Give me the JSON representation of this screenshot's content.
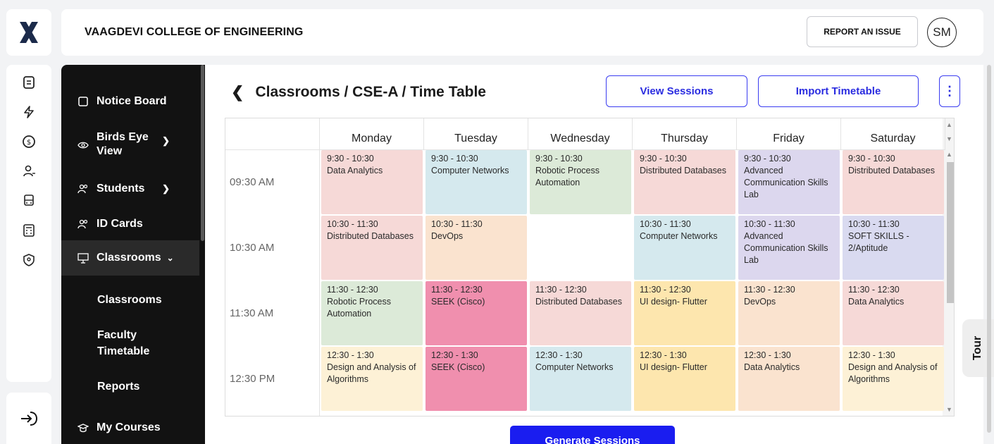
{
  "header": {
    "college_name": "VAAGDEVI COLLEGE OF ENGINEERING",
    "report_label": "REPORT AN ISSUE",
    "avatar_initials": "SM"
  },
  "rail": {
    "icons": [
      "document-icon",
      "flash-icon",
      "coin-icon",
      "user-add-icon",
      "bus-icon",
      "calculator-icon",
      "shield-icon"
    ],
    "logout_icon": "logout-icon"
  },
  "menu": {
    "items": [
      {
        "label": "Notice Board",
        "icon": "square-icon"
      },
      {
        "label": "Birds Eye View",
        "icon": "eye-icon"
      },
      {
        "label": "Students",
        "icon": "users-icon"
      },
      {
        "label": "ID Cards",
        "icon": "users-icon"
      },
      {
        "label": "Classrooms",
        "icon": "presentation-icon"
      },
      {
        "label": "My Courses",
        "icon": "graduation-icon"
      }
    ],
    "birds_eye_line1": "Birds Eye",
    "birds_eye_line2": "View",
    "sub_items": [
      "Classrooms",
      "Faculty",
      "Timetable",
      "Reports"
    ]
  },
  "page": {
    "breadcrumb": "Classrooms / CSE-A / Time Table",
    "view_sessions_label": "View Sessions",
    "import_label": "Import Timetable",
    "generate_label": "Generate Sessions",
    "tour_label": "Tour"
  },
  "timetable": {
    "days": [
      "Monday",
      "Tuesday",
      "Wednesday",
      "Thursday",
      "Friday",
      "Saturday"
    ],
    "time_labels": [
      "09:30 AM",
      "10:30 AM",
      "11:30 AM",
      "12:30 PM"
    ],
    "slots": [
      [
        {
          "time": "9:30 - 10:30",
          "subject": "Data Analytics",
          "color": "#f6d9d7"
        },
        {
          "time": "9:30 - 10:30",
          "subject": "Computer Networks",
          "color": "#d5e9ee"
        },
        {
          "time": "9:30 - 10:30",
          "subject": "Robotic Process Automation",
          "color": "#dcead8"
        },
        {
          "time": "9:30 - 10:30",
          "subject": "Distributed Databases",
          "color": "#f6d9d7"
        },
        {
          "time": "9:30 - 10:30",
          "subject": "Advanced Communication Skills Lab",
          "color": "#dcd7ee"
        },
        {
          "time": "9:30 - 10:30",
          "subject": "Distributed Databases",
          "color": "#f6d9d7"
        }
      ],
      [
        {
          "time": "10:30 - 11:30",
          "subject": "Distributed Databases",
          "color": "#f6d9d7"
        },
        {
          "time": "10:30 - 11:30",
          "subject": "DevOps",
          "color": "#fae3cf"
        },
        null,
        {
          "time": "10:30 - 11:30",
          "subject": "Computer Networks",
          "color": "#d5e9ee"
        },
        {
          "time": "10:30 - 11:30",
          "subject": "Advanced Communication Skills Lab",
          "color": "#dcd7ee"
        },
        {
          "time": "10:30 - 11:30",
          "subject": "SOFT SKILLS - 2/Aptitude",
          "color": "#d9daf0"
        }
      ],
      [
        {
          "time": "11:30 - 12:30",
          "subject": "Robotic Process Automation",
          "color": "#dcead8"
        },
        {
          "time": "11:30 - 12:30",
          "subject": "SEEK (Cisco)",
          "color": "#f08fae"
        },
        {
          "time": "11:30 - 12:30",
          "subject": "Distributed Databases",
          "color": "#f6d9d7"
        },
        {
          "time": "11:30 - 12:30",
          "subject": "UI design- Flutter",
          "color": "#fde6ae"
        },
        {
          "time": "11:30 - 12:30",
          "subject": "DevOps",
          "color": "#fae3cf"
        },
        {
          "time": "11:30 - 12:30",
          "subject": "Data Analytics",
          "color": "#f6d9d7"
        }
      ],
      [
        {
          "time": "12:30 - 1:30",
          "subject": "Design and Analysis of Algorithms",
          "color": "#fdf1d6"
        },
        {
          "time": "12:30 - 1:30",
          "subject": "SEEK (Cisco)",
          "color": "#f08fae"
        },
        {
          "time": "12:30 - 1:30",
          "subject": "Computer Networks",
          "color": "#d5e9ee"
        },
        {
          "time": "12:30 - 1:30",
          "subject": "UI design- Flutter",
          "color": "#fde6ae"
        },
        {
          "time": "12:30 - 1:30",
          "subject": "Data Analytics",
          "color": "#fae3cf"
        },
        {
          "time": "12:30 - 1:30",
          "subject": "Design and Analysis of Algorithms",
          "color": "#fdf1d6"
        }
      ]
    ]
  }
}
